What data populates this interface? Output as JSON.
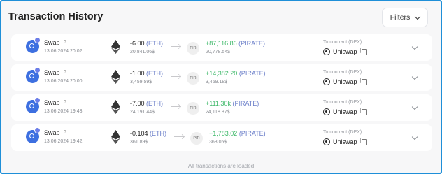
{
  "header": {
    "title": "Transaction History",
    "filters_label": "Filters"
  },
  "transactions": [
    {
      "kind": "Swap",
      "help": "?",
      "date": "13.06.2024 20:02",
      "sent_amount": "-6.00",
      "sent_token": "(ETH)",
      "sent_usd": "20,841.06$",
      "received_token_icon": "PIR",
      "received_amount": "+87,116.86",
      "received_token": "(PIRATE)",
      "received_usd": "20,778.54$",
      "contract_label": "To contract (DEX):",
      "contract_name": "Uniswap"
    },
    {
      "kind": "Swap",
      "help": "?",
      "date": "13.06.2024 20:00",
      "sent_amount": "-1.00",
      "sent_token": "(ETH)",
      "sent_usd": "3,459.59$",
      "received_token_icon": "PIR",
      "received_amount": "+14,382.20",
      "received_token": "(PIRATE)",
      "received_usd": "3,459.18$",
      "contract_label": "To contract (DEX):",
      "contract_name": "Uniswap"
    },
    {
      "kind": "Swap",
      "help": "?",
      "date": "13.06.2024 19:43",
      "sent_amount": "-7.00",
      "sent_token": "(ETH)",
      "sent_usd": "24,191.44$",
      "received_token_icon": "PIR",
      "received_amount": "+111.30k",
      "received_token": "(PIRATE)",
      "received_usd": "24,118.87$",
      "contract_label": "To contract (DEX):",
      "contract_name": "Uniswap"
    },
    {
      "kind": "Swap",
      "help": "?",
      "date": "13.06.2024 19:42",
      "sent_amount": "-0.104",
      "sent_token": "(ETH)",
      "sent_usd": "361.89$",
      "received_token_icon": "PIR",
      "received_amount": "+1,783.02",
      "received_token": "(PIRATE)",
      "received_usd": "363.05$",
      "contract_label": "To contract (DEX):",
      "contract_name": "Uniswap"
    }
  ],
  "footer": {
    "status": "All transactions are loaded"
  },
  "colors": {
    "accent": "#1f8fd8",
    "positive": "#3fb96a",
    "token": "#6a7ec9",
    "swap_icon": "#3d6fe0"
  },
  "icons": {
    "swap": "swap-icon",
    "eth": "ethereum-icon",
    "pirate": "pirate-token-icon",
    "dex": "uniswap-logo-icon",
    "copy": "copy-icon",
    "expand": "chevron-down-icon"
  }
}
